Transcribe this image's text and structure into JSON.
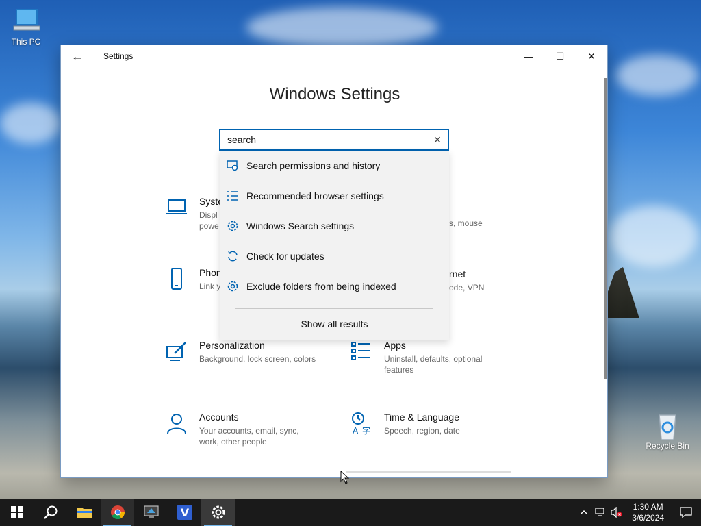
{
  "desktop": {
    "icons": [
      {
        "label": "This PC"
      },
      {
        "label": "Recycle Bin"
      }
    ]
  },
  "window": {
    "title": "Settings",
    "heading": "Windows Settings",
    "controls": {
      "minimize": "—",
      "maximize": "☐",
      "close": "✕"
    }
  },
  "search": {
    "value": "search",
    "clear_icon": "✕"
  },
  "dropdown": {
    "items": [
      {
        "label": "Search permissions and history",
        "icon": "shield-search-icon"
      },
      {
        "label": "Recommended browser settings",
        "icon": "list-icon"
      },
      {
        "label": "Windows Search settings",
        "icon": "gear-icon"
      },
      {
        "label": "Check for updates",
        "icon": "refresh-icon"
      },
      {
        "label": "Exclude folders from being indexed",
        "icon": "gear-icon"
      }
    ],
    "show_all": "Show all results"
  },
  "tiles": [
    {
      "name": "Syste",
      "desc": "Displ\npowe",
      "icon": "laptop-icon"
    },
    {
      "name": "rnet",
      "desc": "ode, VPN",
      "icon": "globe-icon"
    },
    {
      "name": "Phon",
      "desc": "Link y",
      "icon": "phone-icon"
    },
    {
      "name": "",
      "desc": "s, mouse",
      "icon": "keyboard-icon"
    },
    {
      "name": "Personalization",
      "desc": "Background, lock screen, colors",
      "icon": "paint-icon"
    },
    {
      "name": "Apps",
      "desc": "Uninstall, defaults, optional features",
      "icon": "apps-list-icon"
    },
    {
      "name": "Accounts",
      "desc": "Your accounts, email, sync, work, other people",
      "icon": "person-icon"
    },
    {
      "name": "Time & Language",
      "desc": "Speech, region, date",
      "icon": "time-language-icon"
    }
  ],
  "taskbar": {
    "clock_time": "1:30 AM",
    "clock_date": "3/6/2024"
  },
  "colors": {
    "accent": "#0063b1",
    "taskbar": "#1a1a1a"
  }
}
